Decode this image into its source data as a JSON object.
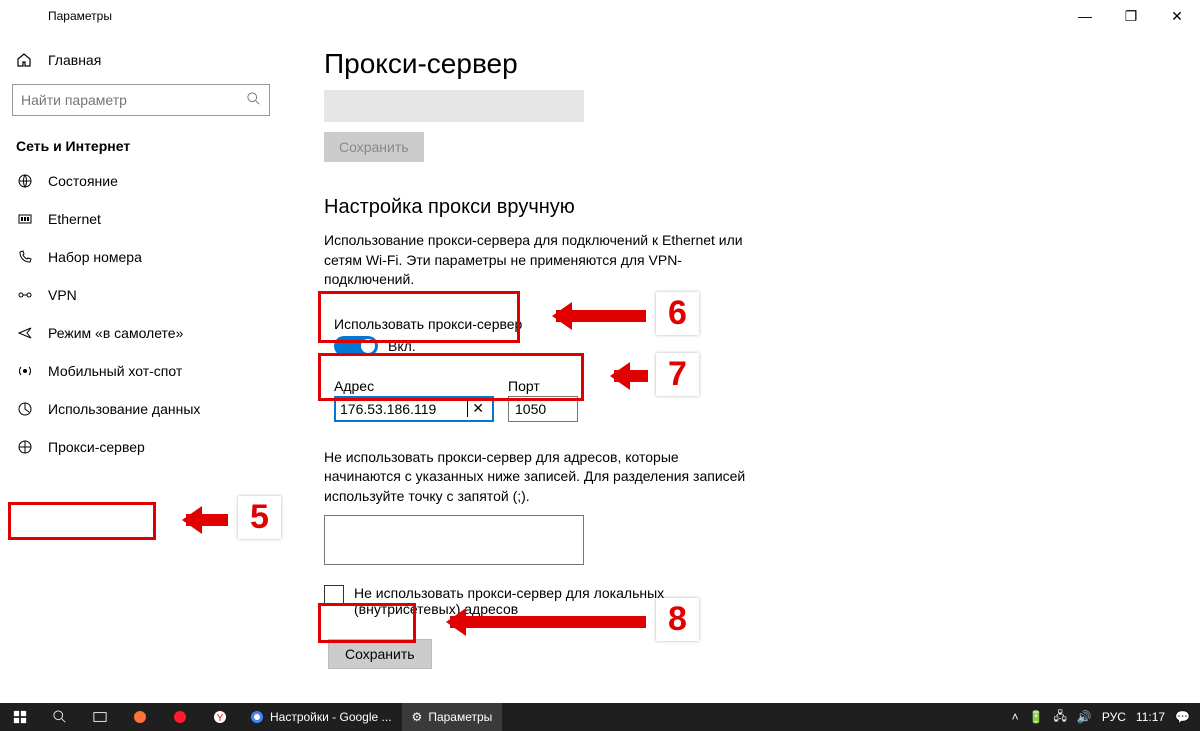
{
  "window": {
    "title": "Параметры",
    "minimize": "—",
    "maximize": "❐",
    "close": "✕"
  },
  "sidebar": {
    "home": "Главная",
    "search_placeholder": "Найти параметр",
    "category": "Сеть и Интернет",
    "items": [
      {
        "icon": "status",
        "label": "Состояние"
      },
      {
        "icon": "ethernet",
        "label": "Ethernet"
      },
      {
        "icon": "dialup",
        "label": "Набор номера"
      },
      {
        "icon": "vpn",
        "label": "VPN"
      },
      {
        "icon": "airplane",
        "label": "Режим «в самолете»"
      },
      {
        "icon": "hotspot",
        "label": "Мобильный хот-спот"
      },
      {
        "icon": "data",
        "label": "Использование данных"
      },
      {
        "icon": "proxy",
        "label": "Прокси-сервер"
      }
    ]
  },
  "main": {
    "title": "Прокси-сервер",
    "save_disabled": "Сохранить",
    "section": "Настройка прокси вручную",
    "desc": "Использование прокси-сервера для подключений к Ethernet или сетям Wi-Fi. Эти параметры не применяются для VPN-подключений.",
    "toggle_label": "Использовать прокси-сервер",
    "toggle_state": "Вкл.",
    "addr_label": "Адрес",
    "addr_value": "176.53.186.119",
    "port_label": "Порт",
    "port_value": "1050",
    "excl_desc": "Не использовать прокси-сервер для адресов, которые начинаются с указанных ниже записей. Для разделения записей используйте точку с запятой (;).",
    "local_label": "Не использовать прокси-сервер для локальных (внутрисетевых) адресов",
    "save": "Сохранить"
  },
  "annotations": {
    "n5": "5",
    "n6": "6",
    "n7": "7",
    "n8": "8"
  },
  "taskbar": {
    "app1": "Настройки - Google ...",
    "app2": "Параметры",
    "lang": "РУС",
    "time": "11:17"
  }
}
